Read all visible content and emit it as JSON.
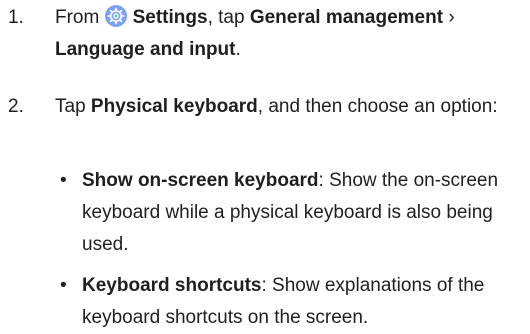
{
  "step1": {
    "number": "1.",
    "prefix": "From ",
    "settings_label": "Settings",
    "mid1": ", tap ",
    "general_management": "General management",
    "separator": " › ",
    "language_input": "Language and input",
    "end": "."
  },
  "step2": {
    "number": "2.",
    "prefix": "Tap ",
    "physical_keyboard": "Physical keyboard",
    "suffix": ", and then choose an option:"
  },
  "options": [
    {
      "bullet": "•",
      "title": "Show on-screen keyboard",
      "description": ": Show the on-screen keyboard while a physical keyboard is also being used."
    },
    {
      "bullet": "•",
      "title": "Keyboard shortcuts",
      "description": ": Show explanations of the keyboard shortcuts on the screen."
    }
  ],
  "icon": "settings-gear-icon",
  "colors": {
    "icon_bg": "#7ea0ff",
    "text": "#1f1f1f"
  }
}
